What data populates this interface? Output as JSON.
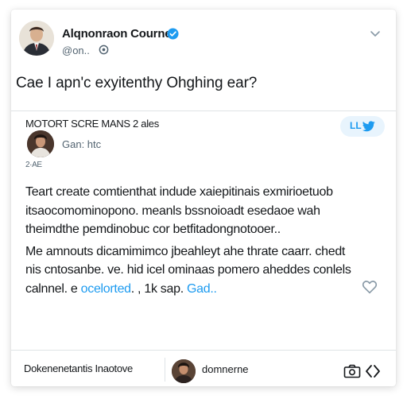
{
  "colors": {
    "verified": "#1d9bf0",
    "twitter_blue": "#1d9bf0",
    "text_primary": "#14171a",
    "text_secondary": "#536471",
    "border": "#dfe3e6"
  },
  "author": {
    "display_name": "Alqnonraon Courne",
    "handle": "@o​n..",
    "verified": true,
    "avatar_icon": "person-portrait-icon"
  },
  "headline": "Cae I apn'c exyitenthy Ohghing ear?",
  "quote": {
    "title": "MOTORT SCRE MANS 2 ales",
    "author_name": "Gan: htc",
    "meta": "2·AE",
    "badge_icon": "twitter-bird-icon",
    "badge_label": "LL"
  },
  "body": {
    "paragraph1": "Teart create comtienthat indude xaiepitinais exmirioetuob itsaocomominopono. meanls bssnoioadt esedaoe wah theimdthe pemdinobuc cor betfitadongnotooer..",
    "paragraph2": "Me amnouts dicamimimco jbeahleyt ahe thrate caarr. chedt nis cntosanbe. ve. hid icel ominaas pomero aheddes conlels calnnel. e ",
    "paragraph2_link_before": "ocelorted",
    "paragraph2_tail": ". , 1k sap. ",
    "paragraph2_link": "Gad.."
  },
  "footer": {
    "left_label": "Dokenenetantis Inaotove",
    "name": "domnerne"
  }
}
